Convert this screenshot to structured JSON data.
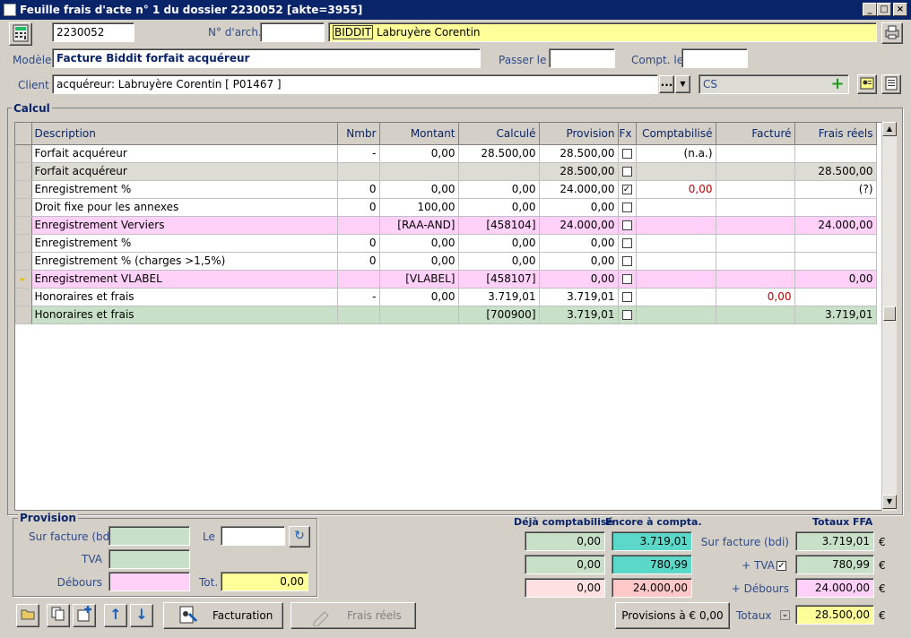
{
  "window": {
    "title": "Feuille frais d'acte n° 1 du dossier 2230052 [akte=3955]"
  },
  "header": {
    "dossier_value": "2230052",
    "narch_label": "N° d'arch.",
    "narch_value": "",
    "name_prefix": "BIDDIT",
    "name_value": " Labruyère Corentin",
    "modele_label": "Modèle",
    "modele_value": "Facture Biddit forfait acquéreur",
    "passer_label": "Passer le",
    "passer_value": "",
    "compt_label": "Compt. le",
    "compt_value": "",
    "client_label": "Client",
    "client_value": "acquéreur: Labruyère Corentin [ P01467 ]",
    "cs_value": "CS",
    "dots_label": "..."
  },
  "calcul": {
    "title": "Calcul",
    "columns": [
      "Description",
      "Nmbr",
      "Montant",
      "Calculé",
      "Provision",
      "Fx",
      "Comptabilisé",
      "Facturé",
      "Frais réels"
    ],
    "rows": [
      {
        "desc": "Forfait acquéreur",
        "nmbr": "-",
        "montant": "0,00",
        "calcule": "28.500,00",
        "provision": "28.500,00",
        "fx": false,
        "compta": "(n.a.)",
        "facture": "",
        "frais": ""
      },
      {
        "desc": "Forfait acquéreur",
        "nmbr": "",
        "montant": "",
        "calcule": "",
        "provision": "28.500,00",
        "fx": false,
        "compta": "",
        "facture": "",
        "frais": "28.500,00"
      },
      {
        "desc": "Enregistrement %",
        "nmbr": "0",
        "montant": "0,00",
        "calcule": "0,00",
        "provision": "24.000,00",
        "fx": true,
        "compta": "0,00",
        "facture": "",
        "frais": "(?)"
      },
      {
        "desc": "Droit fixe pour les annexes",
        "nmbr": "0",
        "montant": "100,00",
        "calcule": "0,00",
        "provision": "0,00",
        "fx": false,
        "compta": "",
        "facture": "",
        "frais": ""
      },
      {
        "desc": "Enregistrement Verviers",
        "nmbr": "",
        "montant": "[RAA-AND]",
        "calcule": "[458104]",
        "provision": "24.000,00",
        "fx": false,
        "compta": "",
        "facture": "",
        "frais": "24.000,00"
      },
      {
        "desc": "Enregistrement %",
        "nmbr": "0",
        "montant": "0,00",
        "calcule": "0,00",
        "provision": "0,00",
        "fx": false,
        "compta": "",
        "facture": "",
        "frais": ""
      },
      {
        "desc": "Enregistrement % (charges >1,5%)",
        "nmbr": "0",
        "montant": "0,00",
        "calcule": "0,00",
        "provision": "0,00",
        "fx": false,
        "compta": "",
        "facture": "",
        "frais": ""
      },
      {
        "desc": "Enregistrement VLABEL",
        "nmbr": "",
        "montant": "[VLABEL]",
        "calcule": "[458107]",
        "provision": "0,00",
        "fx": false,
        "compta": "",
        "facture": "",
        "frais": "0,00"
      },
      {
        "desc": "Honoraires et frais",
        "nmbr": "-",
        "montant": "0,00",
        "calcule": "3.719,01",
        "provision": "3.719,01",
        "fx": false,
        "compta": "",
        "facture": "0,00",
        "frais": ""
      },
      {
        "desc": "Honoraires et frais",
        "nmbr": "",
        "montant": "",
        "calcule": "[700900]",
        "provision": "3.719,01",
        "fx": false,
        "compta": "",
        "facture": "",
        "frais": "3.719,01"
      }
    ]
  },
  "provision": {
    "title": "Provision",
    "sur_facture_label": "Sur facture (bdi)",
    "tva_label": "TVA",
    "debours_label": "Débours",
    "le_label": "Le",
    "tot_label": "Tot.",
    "tot_value": "0,00"
  },
  "summary": {
    "deja_label": "Déjà comptabilisé",
    "encore_label": "Encore à compta.",
    "totaux_ffa_label": "Totaux FFA",
    "sur_facture_label": "Sur facture (bdi)",
    "tva_label": "+ TVA",
    "debours_label": "+ Débours",
    "totaux_label": "Totaux",
    "deja": [
      "0,00",
      "0,00",
      "0,00"
    ],
    "encore": [
      "3.719,01",
      "780,99",
      "24.000,00"
    ],
    "ffa": [
      "3.719,01",
      "780,99",
      "24.000,00"
    ],
    "totaux_value": "28.500,00",
    "euro": "€"
  },
  "footer": {
    "facturation_label": "Facturation",
    "frais_reels_label": "Frais réels",
    "provisions_label": "Provisions à € 0,00"
  },
  "colors": {
    "pink": "#ffd0f8",
    "green": "#c8e0c8",
    "teal": "#5cd8c8",
    "yellow": "#ffff99",
    "salmon": "#ffd8d8"
  }
}
